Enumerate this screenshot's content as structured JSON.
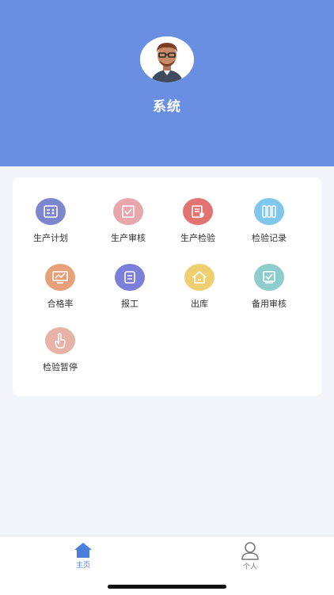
{
  "header": {
    "app_name": "系统",
    "avatar_icon": "person-avatar-icon",
    "background_color": "#6a8fe2"
  },
  "menu": {
    "items": [
      {
        "label": "生产计划",
        "icon": "production-plan-icon",
        "color": "#7b86cf"
      },
      {
        "label": "生产审核",
        "icon": "production-review-icon",
        "color": "#e8a6ae"
      },
      {
        "label": "生产检验",
        "icon": "production-inspection-icon",
        "color": "#e27370"
      },
      {
        "label": "检验记录",
        "icon": "inspection-record-icon",
        "color": "#7fc7ec"
      },
      {
        "label": "合格率",
        "icon": "pass-rate-icon",
        "color": "#e8a07a"
      },
      {
        "label": "报工",
        "icon": "work-report-icon",
        "color": "#7c7fd9"
      },
      {
        "label": "出库",
        "icon": "outbound-icon",
        "color": "#f0cf72"
      },
      {
        "label": "备用审核",
        "icon": "backup-review-icon",
        "color": "#8fcccc"
      },
      {
        "label": "检验暂停",
        "icon": "inspection-pause-icon",
        "color": "#e8b3a6"
      }
    ]
  },
  "tabbar": {
    "tabs": [
      {
        "label": "主页",
        "icon": "home-icon",
        "active": true,
        "color": "#4a7fe0"
      },
      {
        "label": "个人",
        "icon": "person-icon",
        "active": false,
        "color": "#777777"
      }
    ]
  }
}
